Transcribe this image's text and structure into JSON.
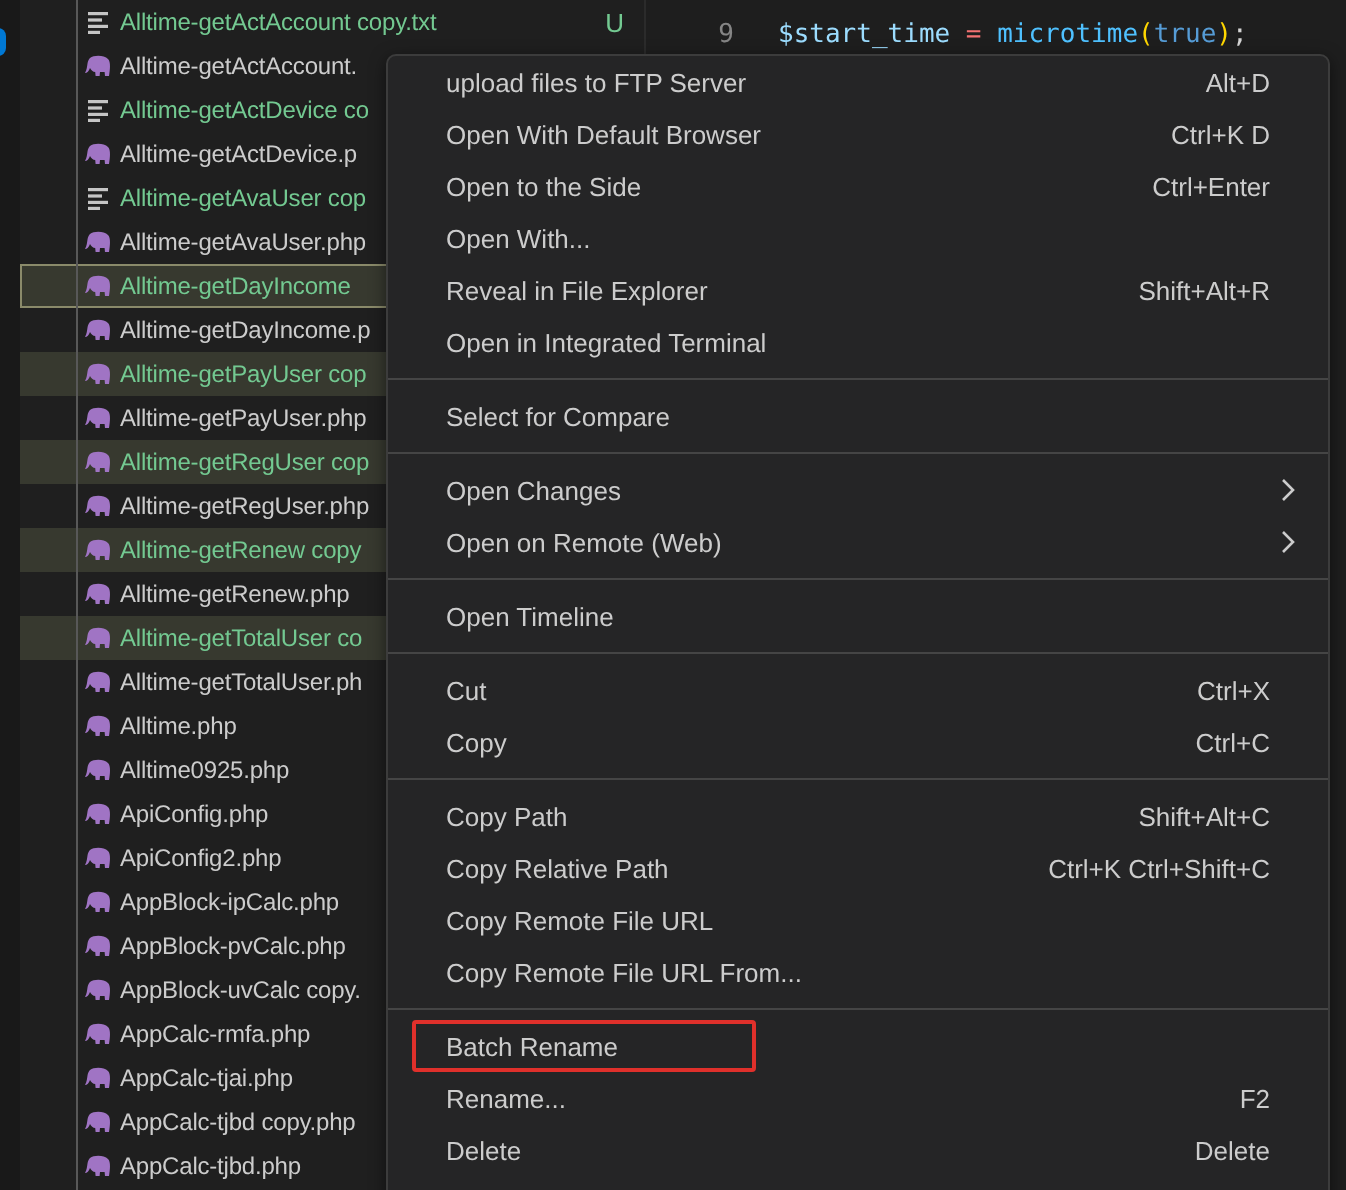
{
  "explorer": {
    "files": [
      {
        "name": "Alltime-getActAccount copy.txt",
        "kind": "text",
        "untracked": true,
        "selected": false,
        "focused": false,
        "badge": "U"
      },
      {
        "name": "Alltime-getActAccount.",
        "kind": "php",
        "untracked": false,
        "selected": false,
        "focused": false
      },
      {
        "name": "Alltime-getActDevice co",
        "kind": "text",
        "untracked": true,
        "selected": false,
        "focused": false
      },
      {
        "name": "Alltime-getActDevice.p",
        "kind": "php",
        "untracked": false,
        "selected": false,
        "focused": false
      },
      {
        "name": "Alltime-getAvaUser cop",
        "kind": "text",
        "untracked": true,
        "selected": false,
        "focused": false
      },
      {
        "name": "Alltime-getAvaUser.php",
        "kind": "php",
        "untracked": false,
        "selected": false,
        "focused": false
      },
      {
        "name": "Alltime-getDayIncome",
        "kind": "php",
        "untracked": true,
        "selected": true,
        "focused": true
      },
      {
        "name": "Alltime-getDayIncome.p",
        "kind": "php",
        "untracked": false,
        "selected": false,
        "focused": false
      },
      {
        "name": "Alltime-getPayUser cop",
        "kind": "php",
        "untracked": true,
        "selected": true,
        "focused": false
      },
      {
        "name": "Alltime-getPayUser.php",
        "kind": "php",
        "untracked": false,
        "selected": false,
        "focused": false
      },
      {
        "name": "Alltime-getRegUser cop",
        "kind": "php",
        "untracked": true,
        "selected": true,
        "focused": false
      },
      {
        "name": "Alltime-getRegUser.php",
        "kind": "php",
        "untracked": false,
        "selected": false,
        "focused": false
      },
      {
        "name": "Alltime-getRenew copy",
        "kind": "php",
        "untracked": true,
        "selected": true,
        "focused": false
      },
      {
        "name": "Alltime-getRenew.php",
        "kind": "php",
        "untracked": false,
        "selected": false,
        "focused": false
      },
      {
        "name": "Alltime-getTotalUser co",
        "kind": "php",
        "untracked": true,
        "selected": true,
        "focused": false
      },
      {
        "name": "Alltime-getTotalUser.ph",
        "kind": "php",
        "untracked": false,
        "selected": false,
        "focused": false
      },
      {
        "name": "Alltime.php",
        "kind": "php",
        "untracked": false,
        "selected": false,
        "focused": false
      },
      {
        "name": "Alltime0925.php",
        "kind": "php",
        "untracked": false,
        "selected": false,
        "focused": false
      },
      {
        "name": "ApiConfig.php",
        "kind": "php",
        "untracked": false,
        "selected": false,
        "focused": false
      },
      {
        "name": "ApiConfig2.php",
        "kind": "php",
        "untracked": false,
        "selected": false,
        "focused": false
      },
      {
        "name": "AppBlock-ipCalc.php",
        "kind": "php",
        "untracked": false,
        "selected": false,
        "focused": false
      },
      {
        "name": "AppBlock-pvCalc.php",
        "kind": "php",
        "untracked": false,
        "selected": false,
        "focused": false
      },
      {
        "name": "AppBlock-uvCalc copy.",
        "kind": "php",
        "untracked": false,
        "selected": false,
        "focused": false
      },
      {
        "name": "AppCalc-rmfa.php",
        "kind": "php",
        "untracked": false,
        "selected": false,
        "focused": false
      },
      {
        "name": "AppCalc-tjai.php",
        "kind": "php",
        "untracked": false,
        "selected": false,
        "focused": false
      },
      {
        "name": "AppCalc-tjbd copy.php",
        "kind": "php",
        "untracked": false,
        "selected": false,
        "focused": false
      },
      {
        "name": "AppCalc-tjbd.php",
        "kind": "php",
        "untracked": false,
        "selected": false,
        "focused": false
      }
    ]
  },
  "editor": {
    "lines": [
      {
        "number": "9",
        "code": [
          {
            "text": "$start_time",
            "color": "#9cdcfe"
          },
          {
            "text": " = ",
            "color": "#f47272"
          },
          {
            "text": "microtime",
            "color": "#4fc1ff"
          },
          {
            "text": "(",
            "color": "#ffd700"
          },
          {
            "text": "true",
            "color": "#569cd6"
          },
          {
            "text": ")",
            "color": "#ffd700"
          },
          {
            "text": ";",
            "color": "#d4d4d4"
          }
        ]
      }
    ]
  },
  "context_menu": {
    "groups": [
      [
        {
          "label": "upload files to FTP Server",
          "shortcut": "Alt+D"
        },
        {
          "label": "Open With Default Browser",
          "shortcut": "Ctrl+K D"
        },
        {
          "label": "Open to the Side",
          "shortcut": "Ctrl+Enter"
        },
        {
          "label": "Open With..."
        },
        {
          "label": "Reveal in File Explorer",
          "shortcut": "Shift+Alt+R"
        },
        {
          "label": "Open in Integrated Terminal"
        }
      ],
      [
        {
          "label": "Select for Compare"
        }
      ],
      [
        {
          "label": "Open Changes",
          "submenu": true
        },
        {
          "label": "Open on Remote (Web)",
          "submenu": true
        }
      ],
      [
        {
          "label": "Open Timeline"
        }
      ],
      [
        {
          "label": "Cut",
          "shortcut": "Ctrl+X"
        },
        {
          "label": "Copy",
          "shortcut": "Ctrl+C"
        }
      ],
      [
        {
          "label": "Copy Path",
          "shortcut": "Shift+Alt+C"
        },
        {
          "label": "Copy Relative Path",
          "shortcut": "Ctrl+K Ctrl+Shift+C"
        },
        {
          "label": "Copy Remote File URL"
        },
        {
          "label": "Copy Remote File URL From..."
        }
      ],
      [
        {
          "label": "Batch Rename",
          "annotated": true
        },
        {
          "label": "Rename...",
          "shortcut": "F2"
        },
        {
          "label": "Delete",
          "shortcut": "Delete"
        }
      ]
    ]
  }
}
